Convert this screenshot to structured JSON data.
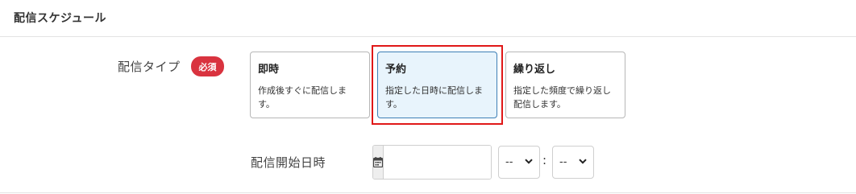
{
  "section": {
    "title": "配信スケジュール"
  },
  "delivery_type": {
    "label": "配信タイプ",
    "required_badge": "必須",
    "options": [
      {
        "title": "即時",
        "description": "作成後すぐに配信します。",
        "selected": false
      },
      {
        "title": "予約",
        "description": "指定した日時に配信します。",
        "selected": true
      },
      {
        "title": "繰り返し",
        "description": "指定した頻度で繰り返し配信します。",
        "selected": false
      }
    ]
  },
  "start_datetime": {
    "label": "配信開始日時",
    "date_value": "",
    "calendar_icon": "calendar-icon",
    "hour_selected": "--",
    "minute_selected": "--",
    "separator": ":"
  },
  "colors": {
    "required_badge": "#d9333f",
    "selected_card_bg": "#e8f4fc",
    "selected_card_border": "#3d7fb6",
    "highlight_frame": "#e01818"
  }
}
